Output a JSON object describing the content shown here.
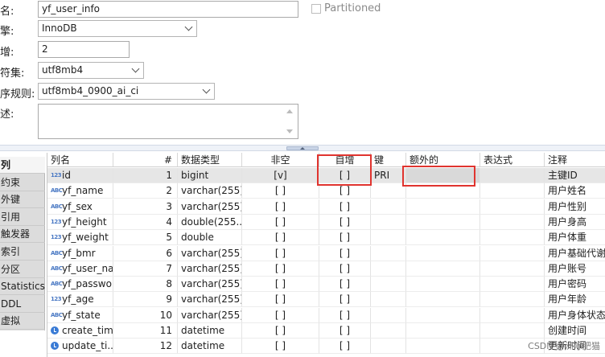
{
  "form": {
    "name_label": "名:",
    "name_value": "yf_user_info",
    "partitioned_label": "Partitioned",
    "engine_label": "擎:",
    "engine_value": "InnoDB",
    "auto_increment_label": "增:",
    "auto_increment_value": "2",
    "charset_label": "符集:",
    "charset_value": "utf8mb4",
    "collation_label": "序规则:",
    "collation_value": "utf8mb4_0900_ai_ci",
    "comment_label": "述:",
    "comment_value": ""
  },
  "left_tabs": [
    {
      "label": "列",
      "active": true
    },
    {
      "label": "约束",
      "active": false
    },
    {
      "label": "外键",
      "active": false
    },
    {
      "label": "引用",
      "active": false
    },
    {
      "label": "触发器",
      "active": false
    },
    {
      "label": "索引",
      "active": false
    },
    {
      "label": "分区",
      "active": false
    },
    {
      "label": "Statistics",
      "active": false
    },
    {
      "label": "DDL",
      "active": false
    },
    {
      "label": "虚拟",
      "active": false
    }
  ],
  "columns": {
    "name": "列名",
    "num": "#",
    "type": "数据类型",
    "not_null": "非空",
    "auto_inc": "自增",
    "key": "键",
    "extra": "额外的",
    "expression": "表达式",
    "comment": "注释"
  },
  "rows": [
    {
      "icon": "123",
      "name": "id",
      "num": "1",
      "type": "bigint",
      "not_null": "[v]",
      "auto_inc": "[ ]",
      "key": "PRI",
      "extra": "",
      "comment": "主键ID"
    },
    {
      "icon": "ABC",
      "name": "yf_name",
      "num": "2",
      "type": "varchar(255)",
      "not_null": "[ ]",
      "auto_inc": "[ ]",
      "key": "",
      "extra": "",
      "comment": "用户姓名"
    },
    {
      "icon": "ABC",
      "name": "yf_sex",
      "num": "3",
      "type": "varchar(255)",
      "not_null": "[ ]",
      "auto_inc": "[ ]",
      "key": "",
      "extra": "",
      "comment": "用户性别"
    },
    {
      "icon": "123",
      "name": "yf_height",
      "num": "4",
      "type": "double(255...",
      "not_null": "[ ]",
      "auto_inc": "[ ]",
      "key": "",
      "extra": "",
      "comment": "用户身高"
    },
    {
      "icon": "123",
      "name": "yf_weight",
      "num": "5",
      "type": "double",
      "not_null": "[ ]",
      "auto_inc": "[ ]",
      "key": "",
      "extra": "",
      "comment": "用户体重"
    },
    {
      "icon": "ABC",
      "name": "yf_bmr",
      "num": "6",
      "type": "varchar(255)",
      "not_null": "[ ]",
      "auto_inc": "[ ]",
      "key": "",
      "extra": "",
      "comment": "用户基础代谢"
    },
    {
      "icon": "ABC",
      "name": "yf_user_na...",
      "num": "7",
      "type": "varchar(255)",
      "not_null": "[ ]",
      "auto_inc": "[ ]",
      "key": "",
      "extra": "",
      "comment": "用户账号"
    },
    {
      "icon": "ABC",
      "name": "yf_passwo...",
      "num": "8",
      "type": "varchar(255)",
      "not_null": "[ ]",
      "auto_inc": "[ ]",
      "key": "",
      "extra": "",
      "comment": "用户密码"
    },
    {
      "icon": "123",
      "name": "yf_age",
      "num": "9",
      "type": "varchar(255)",
      "not_null": "[ ]",
      "auto_inc": "[ ]",
      "key": "",
      "extra": "",
      "comment": "用户年龄"
    },
    {
      "icon": "ABC",
      "name": "yf_state",
      "num": "10",
      "type": "varchar(255)",
      "not_null": "[ ]",
      "auto_inc": "[ ]",
      "key": "",
      "extra": "",
      "comment": "用户身体状态"
    },
    {
      "icon": "clock",
      "name": "create_time",
      "num": "11",
      "type": "datetime",
      "not_null": "[ ]",
      "auto_inc": "[ ]",
      "key": "",
      "extra": "",
      "comment": "创建时间"
    },
    {
      "icon": "clock",
      "name": "update_ti...",
      "num": "12",
      "type": "datetime",
      "not_null": "[ ]",
      "auto_inc": "[ ]",
      "key": "",
      "extra": "",
      "comment": "更新时间"
    }
  ],
  "watermark": "CSDN @洲际肥猫",
  "colors": {
    "annotation_red": "#e0342f",
    "selected_row": "#e6e6e6",
    "icon_blue": "#4a79c4"
  }
}
